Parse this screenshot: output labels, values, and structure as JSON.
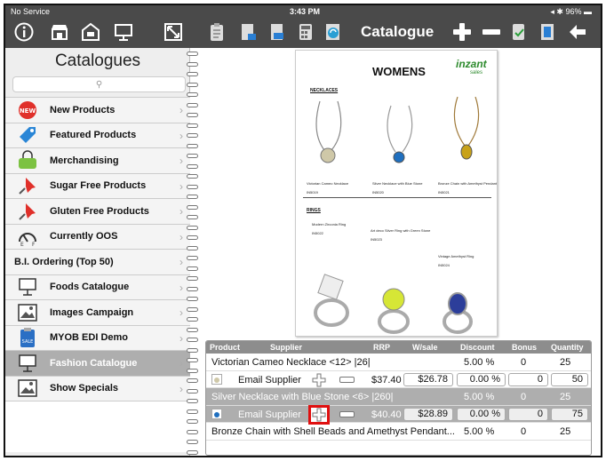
{
  "status_bar": {
    "carrier": "No Service",
    "time": "3:43 PM",
    "battery": "96%"
  },
  "header": {
    "title": "Catalogue"
  },
  "sidebar": {
    "title": "Catalogues",
    "search_placeholder": "",
    "items": [
      {
        "label": "New Products",
        "icon": "new-badge-icon"
      },
      {
        "label": "Featured Products",
        "icon": "tag-icon"
      },
      {
        "label": "Merchandising",
        "icon": "shopping-bag-icon"
      },
      {
        "label": "Sugar Free Products",
        "icon": "pushpin-icon"
      },
      {
        "label": "Gluten Free Products",
        "icon": "pushpin-icon"
      },
      {
        "label": "Currently OOS",
        "icon": "gauge-icon"
      },
      {
        "label": "B.I. Ordering (Top 50)",
        "icon": ""
      },
      {
        "label": "Foods Catalogue",
        "icon": "presentation-board-icon"
      },
      {
        "label": "Images Campaign",
        "icon": "image-icon"
      },
      {
        "label": "MYOB EDI Demo",
        "icon": "sale-clipboard-icon"
      },
      {
        "label": "Fashion Catalogue",
        "icon": "presentation-board-icon"
      },
      {
        "label": "Show Specials",
        "icon": "image-icon"
      }
    ]
  },
  "catalogue_page": {
    "title": "WOMENS",
    "logo": "inzant",
    "logo_sub": "sales",
    "necklaces_heading": "NECKLACES",
    "rings_heading": "RINGS",
    "necklaces": [
      {
        "name": "Victorian Cameo Necklace",
        "code": "IN5019"
      },
      {
        "name": "Silver Necklace with Blue Stone",
        "code": "IN5020"
      },
      {
        "name": "Bronze Chain with Amethyst Pendant",
        "code": "IN5021"
      }
    ],
    "rings": [
      {
        "name": "Modern Zirconia Ring",
        "code": "IN5022"
      },
      {
        "name": "Art deco Silver Ring with Green Stone",
        "code": "IN5023"
      },
      {
        "name": "Vintage Amethyst Ring",
        "code": "IN5024"
      }
    ]
  },
  "table": {
    "columns": [
      "Product",
      "Supplier",
      "RRP",
      "W/sale",
      "Discount",
      "Bonus",
      "Quantity"
    ],
    "rows": [
      {
        "product": "Victorian Cameo Necklace <12> |26|",
        "discount_label": "5.00 %",
        "bonus_label": "0",
        "qty_label": "25",
        "supplier": "Email Supplier",
        "rrp": "$37.40",
        "wsale": "$26.78",
        "discount": "0.00 %",
        "bonus": "0",
        "qty": "50"
      },
      {
        "product": "Silver Necklace with Blue Stone <6> |260|",
        "discount_label": "5.00 %",
        "bonus_label": "0",
        "qty_label": "25",
        "supplier": "Email Supplier",
        "rrp": "$40.40",
        "wsale": "$28.89",
        "discount": "0.00 %",
        "bonus": "0",
        "qty": "75"
      },
      {
        "product": "Bronze Chain with Shell Beads and Amethyst Pendant...",
        "discount_label": "5.00 %",
        "bonus_label": "0",
        "qty_label": "25"
      }
    ]
  }
}
